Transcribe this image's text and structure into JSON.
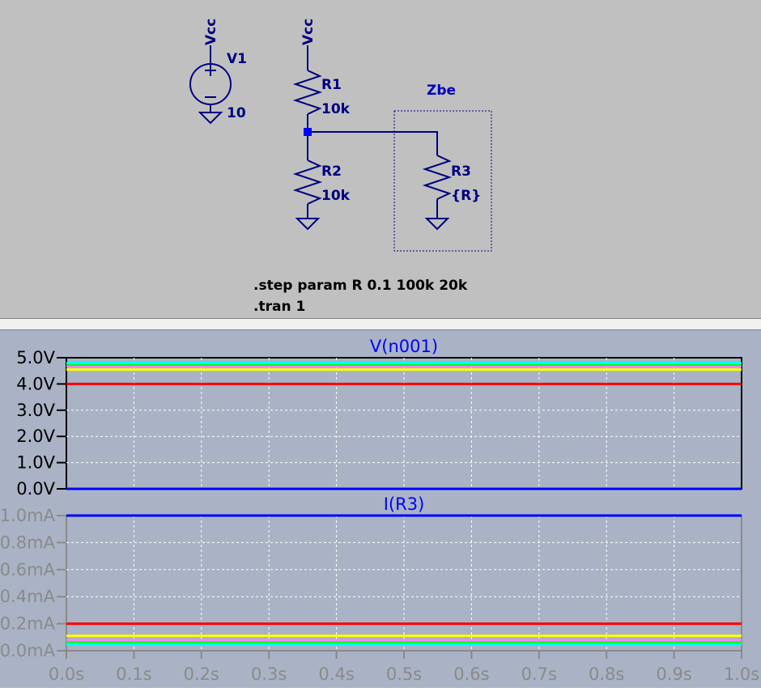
{
  "schematic": {
    "v1": {
      "node_label": "Vcc",
      "name": "V1",
      "value": "10"
    },
    "r1": {
      "supply_label": "Vcc",
      "name": "R1",
      "value": "10k"
    },
    "r2": {
      "name": "R2",
      "value": "10k"
    },
    "r3": {
      "name": "R3",
      "value": "{R}"
    },
    "zbe_label": "Zbe",
    "directives": [
      ".step param R 0.1 100k 20k",
      ".tran 1"
    ],
    "colors": {
      "wire": "#000080",
      "background": "#c0c0c0",
      "label": "#0000c0"
    }
  },
  "waveform": {
    "x_ticks": [
      "0.0s",
      "0.1s",
      "0.2s",
      "0.3s",
      "0.4s",
      "0.5s",
      "0.6s",
      "0.7s",
      "0.8s",
      "0.9s",
      "1.0s"
    ],
    "colors": {
      "background": "#a9b3c5",
      "grid": "#ffffff",
      "series": [
        "#0000ff",
        "#ff0000",
        "#ffff00",
        "#ff80ff",
        "#00ff00"
      ]
    }
  },
  "chart_data": [
    {
      "type": "line",
      "title": "V(n001)",
      "y_ticks": [
        "5.0V",
        "4.0V",
        "3.0V",
        "2.0V",
        "1.0V",
        "0.0V"
      ],
      "x": [
        0,
        1
      ],
      "xlim": [
        0,
        1
      ],
      "ylim": [
        0,
        5
      ],
      "grid": true,
      "series": [
        {
          "color": "#0000ff",
          "values": [
            5e-05,
            5e-05
          ]
        },
        {
          "color": "#ff0000",
          "values": [
            4.0,
            4.0
          ]
        },
        {
          "color": "#ffff00",
          "values": [
            4.55,
            4.55
          ]
        },
        {
          "color": "#ff80ff",
          "values": [
            4.67,
            4.67
          ]
        },
        {
          "color": "#00ff00",
          "values": [
            4.74,
            4.74
          ]
        },
        {
          "color": "#00ffff",
          "values": [
            4.8,
            4.8
          ]
        }
      ]
    },
    {
      "type": "line",
      "title": "I(R3)",
      "y_ticks": [
        "1.0mA",
        "0.8mA",
        "0.6mA",
        "0.4mA",
        "0.2mA",
        "0.0mA"
      ],
      "x": [
        0,
        1
      ],
      "xlim": [
        0,
        1
      ],
      "ylim": [
        0,
        1.0
      ],
      "grid": true,
      "series": [
        {
          "color": "#0000ff",
          "values": [
            1.0,
            1.0
          ]
        },
        {
          "color": "#ff0000",
          "values": [
            0.2,
            0.2
          ]
        },
        {
          "color": "#ffff00",
          "values": [
            0.11,
            0.11
          ]
        },
        {
          "color": "#ff80ff",
          "values": [
            0.078,
            0.078
          ]
        },
        {
          "color": "#00ff00",
          "values": [
            0.06,
            0.06
          ]
        },
        {
          "color": "#00ffff",
          "values": [
            0.048,
            0.048
          ]
        }
      ]
    }
  ]
}
